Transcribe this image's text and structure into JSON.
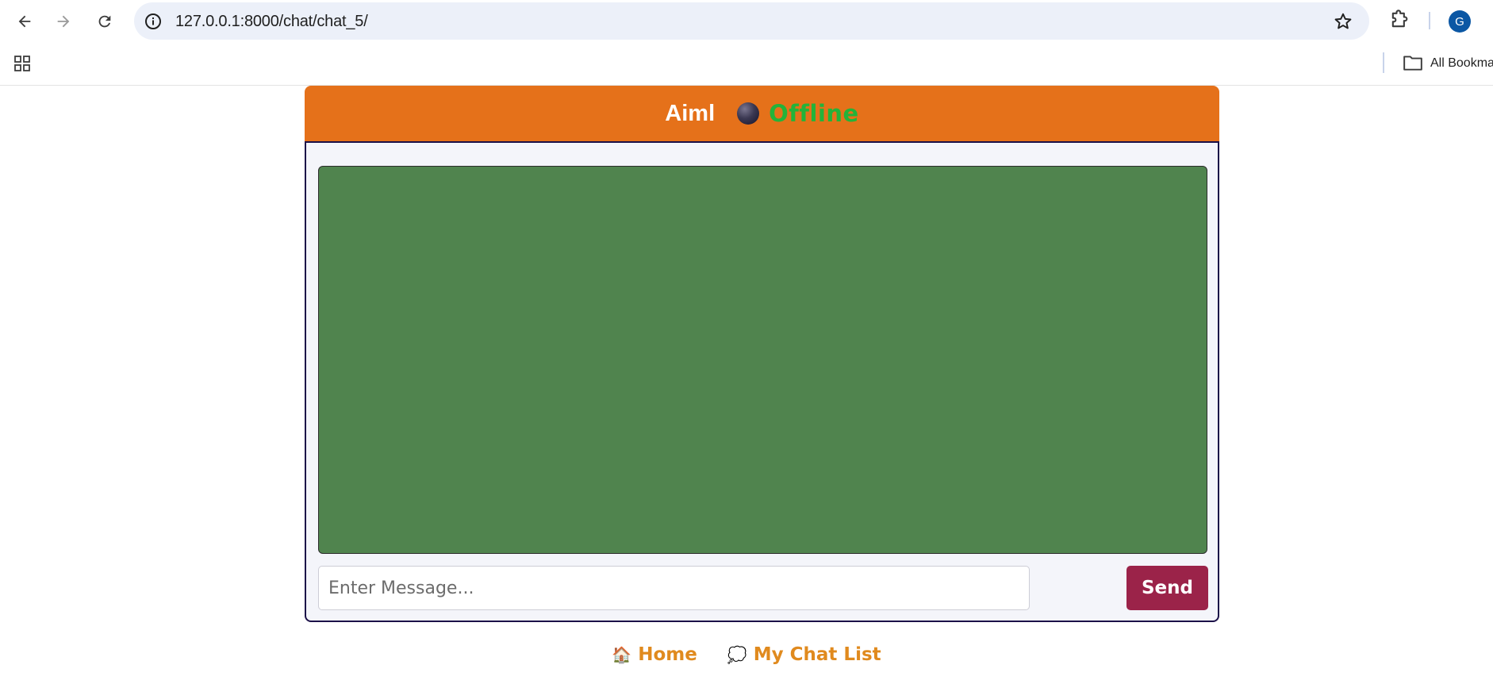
{
  "browser": {
    "url": "127.0.0.1:8000/chat/chat_5/",
    "profile_initial": "G",
    "bookmarks_label": "All Bookmarks"
  },
  "chat": {
    "title": "Aiml",
    "status": "Offline",
    "status_color": "#23b33a",
    "header_color": "#e5711a",
    "log_color": "#50844e",
    "input_placeholder": "Enter Message...",
    "send_label": "Send",
    "send_color": "#9b2349"
  },
  "footer": {
    "home_icon": "🏠",
    "home_label": "Home",
    "chatlist_icon": "💭",
    "chatlist_label": "My Chat List",
    "link_color": "#e08a1e"
  }
}
